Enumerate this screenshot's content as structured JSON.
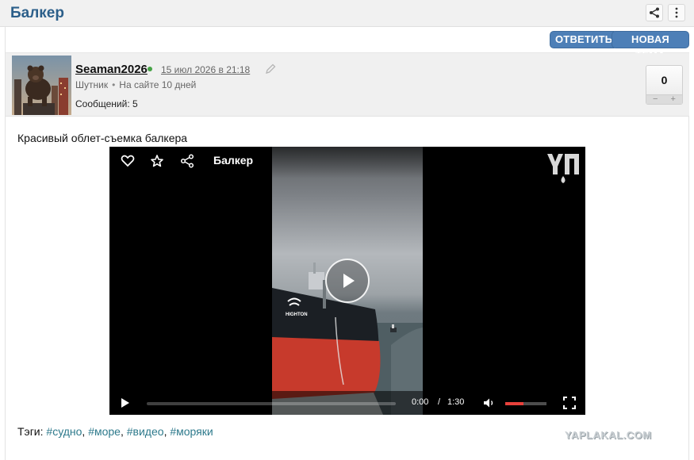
{
  "topic": {
    "title": "Балкер"
  },
  "actions": {
    "reply_label": "ОТВЕТИТЬ",
    "new_topic_label": "НОВАЯ ТЕМА"
  },
  "post": {
    "username": "Seaman2026",
    "date": "15 июл 2026 в 21:18",
    "rank": "Шутник",
    "on_site": "На сайте 10 дней",
    "messages": "Сообщений: 5",
    "rating": "0",
    "rating_minus": "−",
    "rating_plus": "+",
    "text": "Красивый облет-съемка балкера"
  },
  "video": {
    "title": "Балкер",
    "time_current": "0:00",
    "time_separator": "/",
    "time_duration": "1:30",
    "progress": 0,
    "volume": 0.45,
    "hull_text": "HIGHTON"
  },
  "tags": {
    "label": "Тэги:",
    "items": [
      "#судно",
      "#море",
      "#видео",
      "#моряки"
    ]
  },
  "watermark": "YAPLAKAL.COM",
  "colors": {
    "title": "#2c5f8a",
    "button": "#4d7fb7",
    "tag": "#2e7a8c",
    "online": "#46a346",
    "volume_fill": "#e8413b"
  }
}
